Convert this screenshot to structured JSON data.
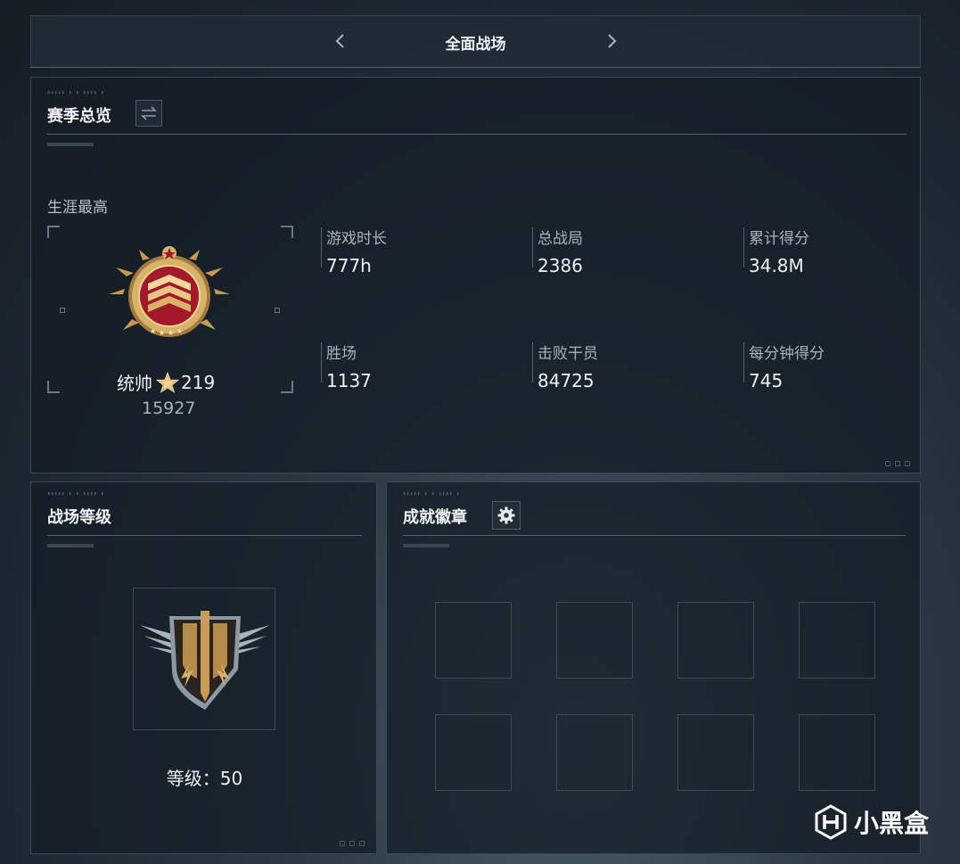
{
  "header": {
    "title": "全面战场",
    "prev_icon": "chevron-left-icon",
    "next_icon": "chevron-right-icon"
  },
  "season": {
    "title": "赛季总览",
    "switch_icon": "swap-arrows-icon",
    "career_label": "生涯最高",
    "rank": {
      "name": "统帅",
      "star_count": "219",
      "points": "15927",
      "medal_icon": "marshal-rank-medal"
    },
    "stats": [
      {
        "label": "游戏时长",
        "value": "777h"
      },
      {
        "label": "总战局",
        "value": "2386"
      },
      {
        "label": "累计得分",
        "value": "34.8M"
      },
      {
        "label": "胜场",
        "value": "1137"
      },
      {
        "label": "击败干员",
        "value": "84725"
      },
      {
        "label": "每分钟得分",
        "value": "745"
      }
    ]
  },
  "battlefield_level": {
    "title": "战场等级",
    "level_text": "等级：50",
    "emblem_icon": "winged-shield-emblem"
  },
  "achievements": {
    "title": "成就徽章",
    "settings_icon": "gear-icon",
    "slots": 8
  },
  "watermark": {
    "text": "小黑盒",
    "logo_icon": "xiaoheihe-logo-icon"
  },
  "colors": {
    "medal_gold": "#d6ae5e",
    "medal_red": "#a3182a",
    "text_primary": "#eef1f3",
    "text_secondary": "#aab3ba"
  }
}
